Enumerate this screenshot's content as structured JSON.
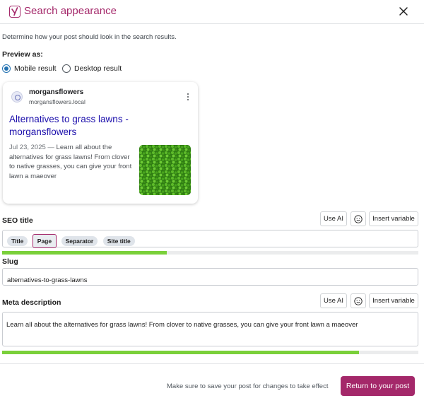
{
  "header": {
    "title": "Search appearance",
    "logo_icon": "yoast-logo-icon",
    "close_icon": "close-icon"
  },
  "intro_text": "Determine how your post should look in the search results.",
  "preview": {
    "label": "Preview as:",
    "options": [
      {
        "label": "Mobile result",
        "selected": true
      },
      {
        "label": "Desktop result",
        "selected": false
      }
    ]
  },
  "serp_card": {
    "site_name": "morgansflowers",
    "site_url": "morgansflowers.local",
    "title": "Alternatives to grass lawns - morgansflowers",
    "date": "Jul 23, 2025",
    "separator": " — ",
    "description": "Learn all about the alternatives for grass lawns! From clover to native grasses, you can give your front lawn a maeover",
    "menu_icon": "more-vertical-icon"
  },
  "seo_title": {
    "label": "SEO title",
    "use_ai_label": "Use AI",
    "emoji_icon": "emoji-icon",
    "insert_variable_label": "Insert variable",
    "pills": [
      "Title",
      "Page",
      "Separator",
      "Site title"
    ],
    "progress": 0.395
  },
  "slug": {
    "label": "Slug",
    "value": "alternatives-to-grass-lawns"
  },
  "meta_description": {
    "label": "Meta description",
    "use_ai_label": "Use AI",
    "emoji_icon": "emoji-icon",
    "insert_variable_label": "Insert variable",
    "value": "Learn all about the alternatives for grass lawns! From clover to native grasses, you can give your front lawn a maeover",
    "progress": 0.857
  },
  "footer": {
    "note": "Make sure to save your post for changes to take effect",
    "primary_button_label": "Return to your post"
  },
  "colors": {
    "brand": "#a4286a",
    "link": "#1a0dab",
    "progress_good": "#7ad03a",
    "radio_accent": "#2271b1"
  }
}
